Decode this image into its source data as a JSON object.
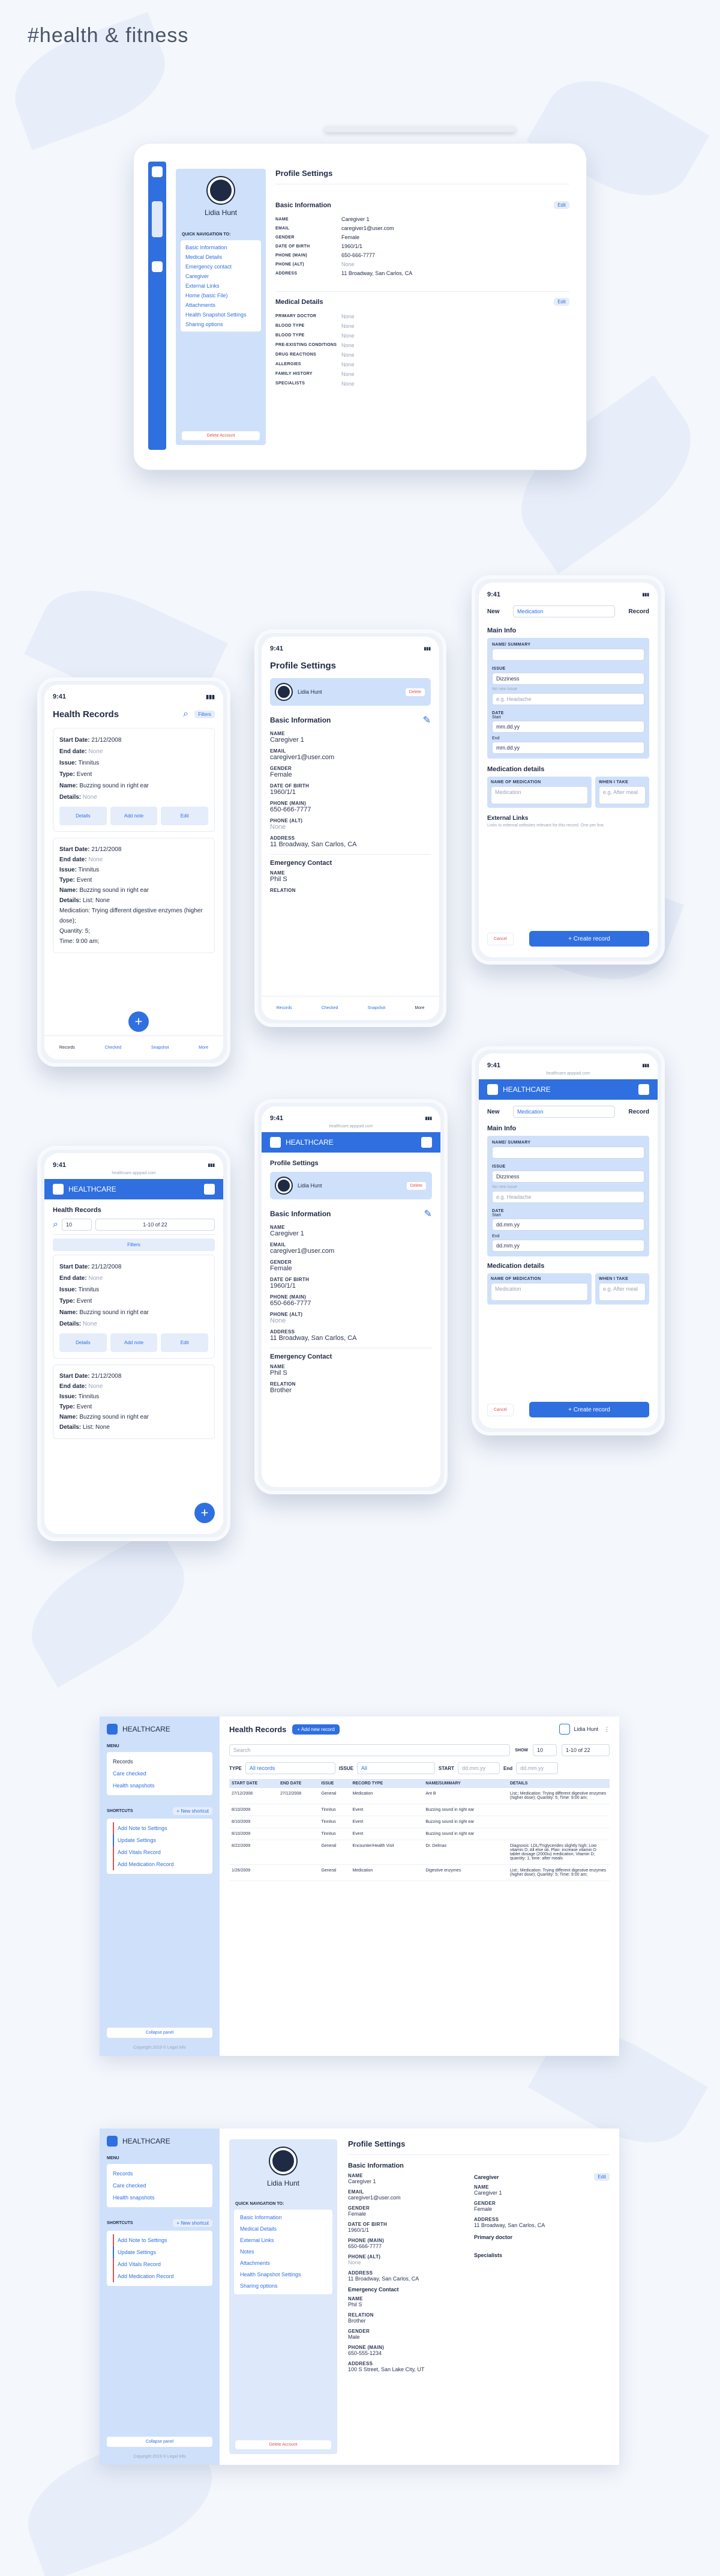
{
  "page_title": "#health & fitness",
  "tablet": {
    "profile_title": "Profile Settings",
    "user_name": "Lidia Hunt",
    "quick_nav_title": "QUICK NAVIGATION TO:",
    "nav": [
      "Basic Information",
      "Medical Details",
      "Emergency contact",
      "Caregiver",
      "External Links",
      "Home (basic File)",
      "Attachments",
      "Health Snapshot Settings",
      "Sharing options"
    ],
    "delete_label": "Delete Account",
    "basic_title": "Basic Information",
    "edit": "Edit",
    "fields": [
      {
        "k": "NAME",
        "v": "Caregiver 1"
      },
      {
        "k": "EMAIL",
        "v": "caregiver1@user.com"
      },
      {
        "k": "GENDER",
        "v": "Female"
      },
      {
        "k": "DATE OF BIRTH",
        "v": "1960/1/1"
      },
      {
        "k": "PHONE (MAIN)",
        "v": "650-666-7777"
      },
      {
        "k": "PHONE (ALT)",
        "v": "None"
      },
      {
        "k": "ADDRESS",
        "v": "11 Broadway, San Carlos, CA"
      }
    ],
    "medical_title": "Medical Details",
    "medical_fields": [
      "PRIMARY DOCTOR",
      "BLOOD TYPE",
      "BLOOD TYPE",
      "PRE-EXISTING CONDITIONS",
      "DRUG REACTIONS",
      "ALLERGIES",
      "FAMILY HISTORY",
      "SPECIALISTS"
    ],
    "none": "None"
  },
  "phone_records": {
    "time": "9:41",
    "title": "Health Records",
    "filters": "Filters",
    "record1": {
      "start_label": "Start Date:",
      "start": "21/12/2008",
      "end_label": "End date:",
      "end": "None",
      "issue_label": "Issue:",
      "issue": "Tinnitus",
      "type_label": "Type:",
      "type": "Event",
      "name_label": "Name:",
      "name": "Buzzing sound in right ear",
      "details_label": "Details:",
      "details": "None"
    },
    "actions": [
      "Details",
      "Add note",
      "Edit"
    ],
    "record2": {
      "start": "21/12/2008",
      "end": "None",
      "issue": "Tinnitus",
      "type": "Event",
      "name": "Buzzing sound in right ear",
      "details": "List: None",
      "med": "Medication: Trying different digestive enzymes (higher dose);",
      "qty": "Quantity: 5;",
      "time": "Time: 9:00 am;"
    },
    "tabs": [
      "Records",
      "Checked",
      "Snapshot",
      "More"
    ]
  },
  "phone_profile": {
    "time": "9:41",
    "title": "Profile Settings",
    "user": "Lidia Hunt",
    "delete": "Delete",
    "basic": "Basic Information",
    "fields": [
      {
        "k": "NAME",
        "v": "Caregiver 1"
      },
      {
        "k": "EMAIL",
        "v": "caregiver1@user.com"
      },
      {
        "k": "GENDER",
        "v": "Female"
      },
      {
        "k": "DATE OF BIRTH",
        "v": "1960/1/1"
      },
      {
        "k": "PHONE (MAIN)",
        "v": "650-666-7777"
      },
      {
        "k": "PHONE (ALT)",
        "v": "None"
      },
      {
        "k": "ADDRESS",
        "v": "11 Broadway, San Carlos, CA"
      }
    ],
    "emergency": "Emergency Contact",
    "em_name_k": "NAME",
    "em_name": "Phil S",
    "em_rel_k": "RELATION",
    "em_rel": "Brother",
    "tabs": [
      "Records",
      "Checked",
      "Snapshot",
      "More"
    ]
  },
  "phone_new": {
    "time": "9:41",
    "new": "New",
    "type": "Medication",
    "record": "Record",
    "main_info": "Main Info",
    "name_summary": "NAME/ SUMMARY",
    "issue": "ISSUE",
    "issue_val": "Dizziness",
    "no_issue": "No new issue",
    "placeholder_issue": "e.g. Headache",
    "dates": "DATE",
    "start": "Start",
    "date_ph": "mm.dd.yy",
    "end": "End",
    "med_details": "Medication details",
    "name_med": "NAME OF MEDICATION",
    "what_take": "WHEN I TAKE",
    "med_ph": "Medication",
    "take_ph": "e.g. After meal",
    "external": "External Links",
    "external_desc": "Links to external websites relevant for this record. One per line.",
    "cancel": "Cancel",
    "create": "+ Create record"
  },
  "mobile_web": {
    "url": "healthcare.apppad.com",
    "brand": "HEALTHCARE",
    "records_title": "Health Records",
    "per_page": "10",
    "pager": "1-10 of 22",
    "filters": "Filters",
    "profile_title": "Profile Settings",
    "date_ph": "dd.mm.yy"
  },
  "desktop_records": {
    "brand": "HEALTHCARE",
    "menu": "MENU",
    "menu_items": [
      "Records",
      "Care checked",
      "Health snapshots"
    ],
    "shortcuts": "SHORTCUTS",
    "new_shortcut": "+ New shortcut",
    "shortcut_items": [
      "Add Note to Settings",
      "Update Settings",
      "Add Vitals Record",
      "Add Medication Record"
    ],
    "collapse": "Collapse panel",
    "copyright": "Copyright 2019 © Legal Info",
    "title": "Health Records",
    "add_record": "+ Add new record",
    "user": "Lidia Hunt",
    "search_ph": "Search",
    "show": "SHOW",
    "show_val": "10",
    "pager": "1-10 of 22",
    "type_lbl": "TYPE",
    "type_val": "All records",
    "issue_lbl": "ISSUE",
    "issue_val": "All",
    "start_lbl": "START",
    "end_lbl": "End",
    "columns": [
      "START DATE",
      "END DATE",
      "ISSUE",
      "RECORD TYPE",
      "NAME/SUMMARY",
      "DETAILS"
    ],
    "rows": [
      [
        "27/12/2008",
        "27/12/2008",
        "General",
        "Medication",
        "Ant B",
        "List:; Medication: Trying different digestive enzymes (higher dose); Quantity: 5; Time: 9:00 am;"
      ],
      [
        "8/10/2009",
        "",
        "Tinnitus",
        "Event",
        "Buzzing sound in right ear",
        ""
      ],
      [
        "8/10/2009",
        "",
        "Tinnitus",
        "Event",
        "Buzzing sound in right ear",
        ""
      ],
      [
        "8/10/2009",
        "",
        "Tinnitus",
        "Event",
        "Buzzing sound in right ear",
        ""
      ],
      [
        "8/22/2009",
        "",
        "General",
        "Encounter/Health Visit",
        "Dr. Delmas",
        "Diagnosis: LDL/Triglycerides slightly high; Low vitamin D; All else ok. Plan: increase vitamin D tablet dosage (2000iu) medication; Vitamin D; quantity: 1; time: after meals"
      ],
      [
        "1/26/2009",
        "",
        "General",
        "Medication",
        "Digestive enzymes",
        "List:; Medication: Trying different digestive enzymes (higher dose); Quantity: 5; Time: 9:00 am;"
      ]
    ]
  },
  "desktop_profile": {
    "title": "Profile Settings",
    "user": "Lidia Hunt",
    "quick_nav": "QUICK NAVIGATION TO:",
    "nav": [
      "Basic Information",
      "Medical Details",
      "External Links",
      "Notes",
      "Attachments",
      "Health Snapshot Settings",
      "Sharing options"
    ],
    "delete": "Delete Account",
    "basic": "Basic Information",
    "edit": "Edit",
    "left_fields": [
      {
        "k": "NAME",
        "v": "Caregiver 1"
      },
      {
        "k": "EMAIL",
        "v": "caregiver1@user.com"
      },
      {
        "k": "GENDER",
        "v": "Female"
      },
      {
        "k": "DATE OF BIRTH",
        "v": "1960/1/1"
      },
      {
        "k": "PHONE (MAIN)",
        "v": "650-666-7777"
      },
      {
        "k": "PHONE (ALT)",
        "v": "None"
      },
      {
        "k": "ADDRESS",
        "v": "11 Broadway, San Carlos, CA"
      }
    ],
    "caregiver": "Caregiver",
    "right_fields": [
      {
        "k": "NAME",
        "v": "Caregiver 1"
      },
      {
        "k": "GENDER",
        "v": "Female"
      },
      {
        "k": "ADDRESS",
        "v": "11 Broadway, San Carlos, CA"
      }
    ],
    "primary_doctor": "Primary doctor",
    "specialists": "Specialists",
    "emergency": "Emergency Contact",
    "em_fields": [
      {
        "k": "NAME",
        "v": "Phil S"
      },
      {
        "k": "RELATION",
        "v": "Brother"
      },
      {
        "k": "GENDER",
        "v": "Male"
      },
      {
        "k": "PHONE (MAIN)",
        "v": "650-555-1234"
      },
      {
        "k": "ADDRESS",
        "v": "100 S Street, San Lake City, UT"
      }
    ]
  }
}
